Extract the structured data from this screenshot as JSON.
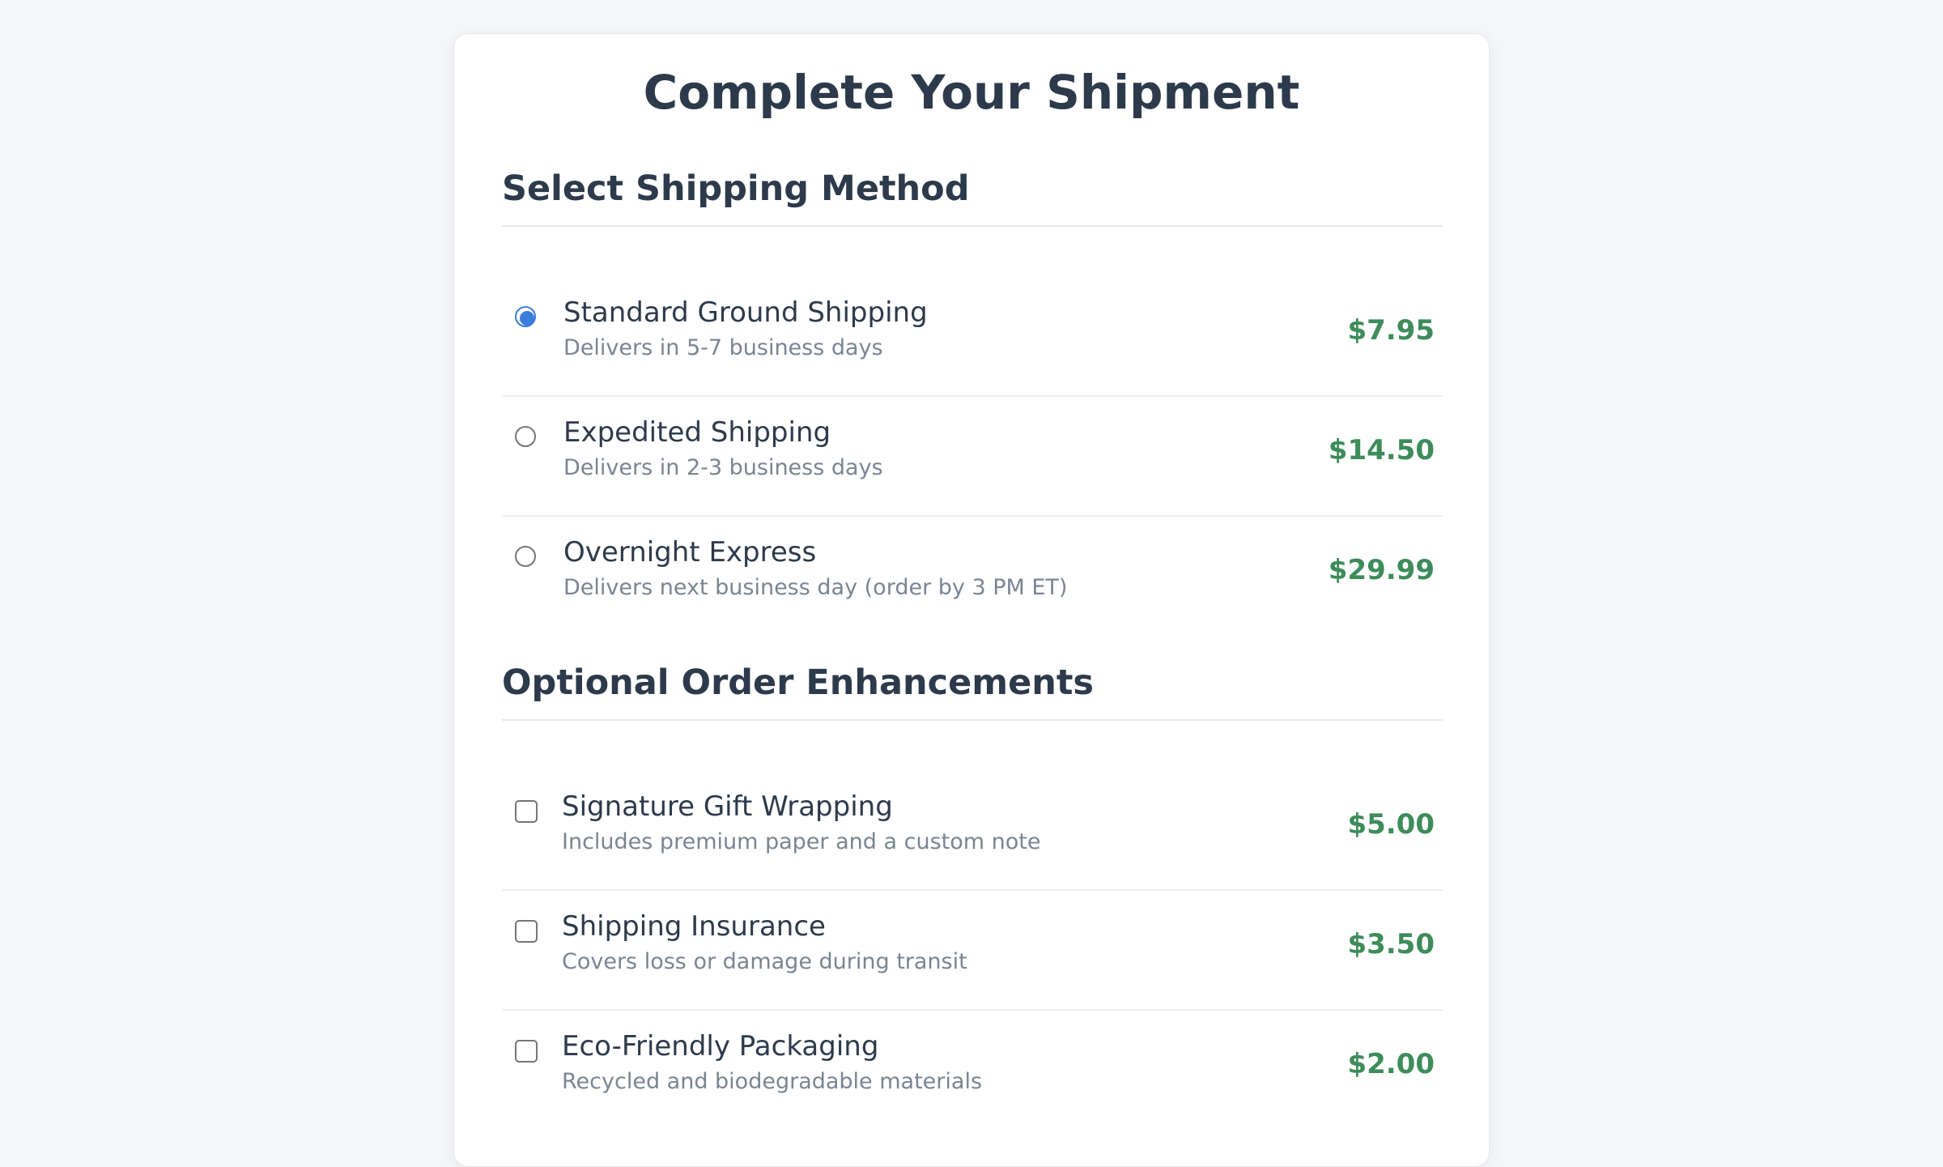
{
  "page": {
    "title": "Complete Your Shipment"
  },
  "shipping": {
    "section_title": "Select Shipping Method",
    "options": [
      {
        "name": "Standard Ground Shipping",
        "description": "Delivers in 5-7 business days",
        "price": "$7.95",
        "selected": true
      },
      {
        "name": "Expedited Shipping",
        "description": "Delivers in 2-3 business days",
        "price": "$14.50",
        "selected": false
      },
      {
        "name": "Overnight Express",
        "description": "Delivers next business day (order by 3 PM ET)",
        "price": "$29.99",
        "selected": false
      }
    ]
  },
  "enhancements": {
    "section_title": "Optional Order Enhancements",
    "options": [
      {
        "name": "Signature Gift Wrapping",
        "description": "Includes premium paper and a custom note",
        "price": "$5.00",
        "checked": false
      },
      {
        "name": "Shipping Insurance",
        "description": "Covers loss or damage during transit",
        "price": "$3.50",
        "checked": false
      },
      {
        "name": "Eco-Friendly Packaging",
        "description": "Recycled and biodegradable materials",
        "price": "$2.00",
        "checked": false
      }
    ]
  },
  "colors": {
    "accent": "#3b7ddd",
    "price": "#3d8c5a",
    "text": "#2d3a4b",
    "muted": "#7a8593"
  }
}
